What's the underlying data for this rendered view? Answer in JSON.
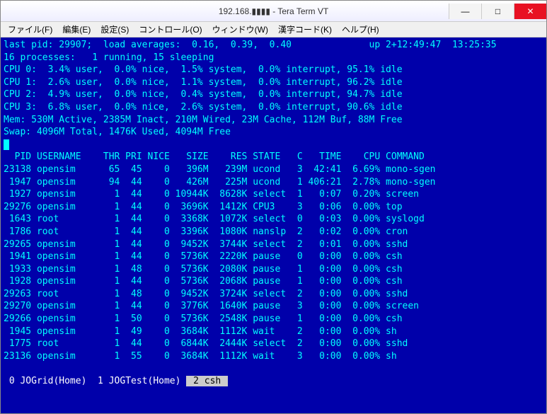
{
  "window": {
    "title": "192.168.▮▮▮▮ - Tera Term VT",
    "min": "—",
    "max": "□",
    "close": "✕"
  },
  "menu": {
    "file": "ファイル(F)",
    "edit": "編集(E)",
    "settings": "設定(S)",
    "control": "コントロール(O)",
    "window": "ウィンドウ(W)",
    "kanji": "漢字コード(K)",
    "help": "ヘルプ(H)"
  },
  "term": {
    "header1": "last pid: 29907;  load averages:  0.16,  0.39,  0.40              up 2+12:49:47  13:25:35",
    "header2": "16 processes:   1 running, 15 sleeping",
    "cpu0": "CPU 0:  3.4% user,  0.0% nice,  1.5% system,  0.0% interrupt, 95.1% idle",
    "cpu1": "CPU 1:  2.6% user,  0.0% nice,  1.1% system,  0.0% interrupt, 96.2% idle",
    "cpu2": "CPU 2:  4.9% user,  0.0% nice,  0.4% system,  0.0% interrupt, 94.7% idle",
    "cpu3": "CPU 3:  6.8% user,  0.0% nice,  2.6% system,  0.0% interrupt, 90.6% idle",
    "mem": "Mem: 530M Active, 2385M Inact, 210M Wired, 23M Cache, 112M Buf, 88M Free",
    "swap": "Swap: 4096M Total, 1476K Used, 4094M Free",
    "cols": "  PID USERNAME    THR PRI NICE   SIZE    RES STATE   C   TIME    CPU COMMAND",
    "rows": [
      "23138 opensim      65  45    0   396M   239M ucond   3  42:41  6.69% mono-sgen",
      " 1947 opensim      94  44    0   426M   225M ucond   1 406:21  2.78% mono-sgen",
      " 1927 opensim       1  44    0 10944K  8628K select  1   0:07  0.20% screen",
      "29276 opensim       1  44    0  3696K  1412K CPU3    3   0:06  0.00% top",
      " 1643 root          1  44    0  3368K  1072K select  0   0:03  0.00% syslogd",
      " 1786 root          1  44    0  3396K  1080K nanslp  2   0:02  0.00% cron",
      "29265 opensim       1  44    0  9452K  3744K select  2   0:01  0.00% sshd",
      " 1941 opensim       1  44    0  5736K  2220K pause   0   0:00  0.00% csh",
      " 1933 opensim       1  48    0  5736K  2080K pause   1   0:00  0.00% csh",
      " 1928 opensim       1  44    0  5736K  2068K pause   1   0:00  0.00% csh",
      "29263 root          1  48    0  9452K  3724K select  2   0:00  0.00% sshd",
      "29270 opensim       1  44    0  3776K  1640K pause   3   0:00  0.00% screen",
      "29266 opensim       1  50    0  5736K  2548K pause   1   0:00  0.00% csh",
      " 1945 opensim       1  49    0  3684K  1112K wait    2   0:00  0.00% sh",
      " 1775 root          1  44    0  6844K  2444K select  2   0:00  0.00% sshd",
      "23136 opensim       1  55    0  3684K  1112K wait    3   0:00  0.00% sh"
    ],
    "tabs": {
      "t0": " 0 JOGrid(Home) ",
      "t1": " 1 JOGTest(Home) ",
      "t2": " 2 csh "
    }
  }
}
